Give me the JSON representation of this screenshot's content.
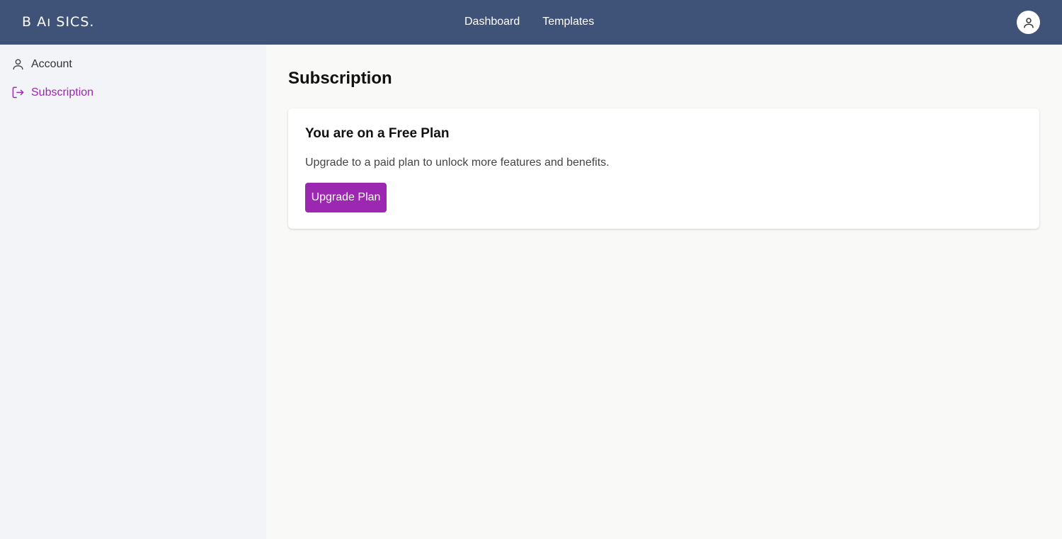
{
  "header": {
    "logo": "B Aı SICS.",
    "nav": [
      {
        "label": "Dashboard"
      },
      {
        "label": "Templates"
      }
    ],
    "avatar_icon": "user-icon"
  },
  "sidebar": {
    "items": [
      {
        "label": "Account",
        "icon": "user-icon",
        "active": false
      },
      {
        "label": "Subscription",
        "icon": "logout-arrow-icon",
        "active": true
      }
    ]
  },
  "main": {
    "title": "Subscription",
    "card": {
      "title": "You are on a Free Plan",
      "description": "Upgrade to a paid plan to unlock more features and benefits.",
      "button_label": "Upgrade Plan"
    }
  },
  "colors": {
    "header_bg": "#3f5378",
    "accent": "#9c27b0",
    "sidebar_bg": "#f2f4f7",
    "page_bg": "#f9f9f8"
  }
}
